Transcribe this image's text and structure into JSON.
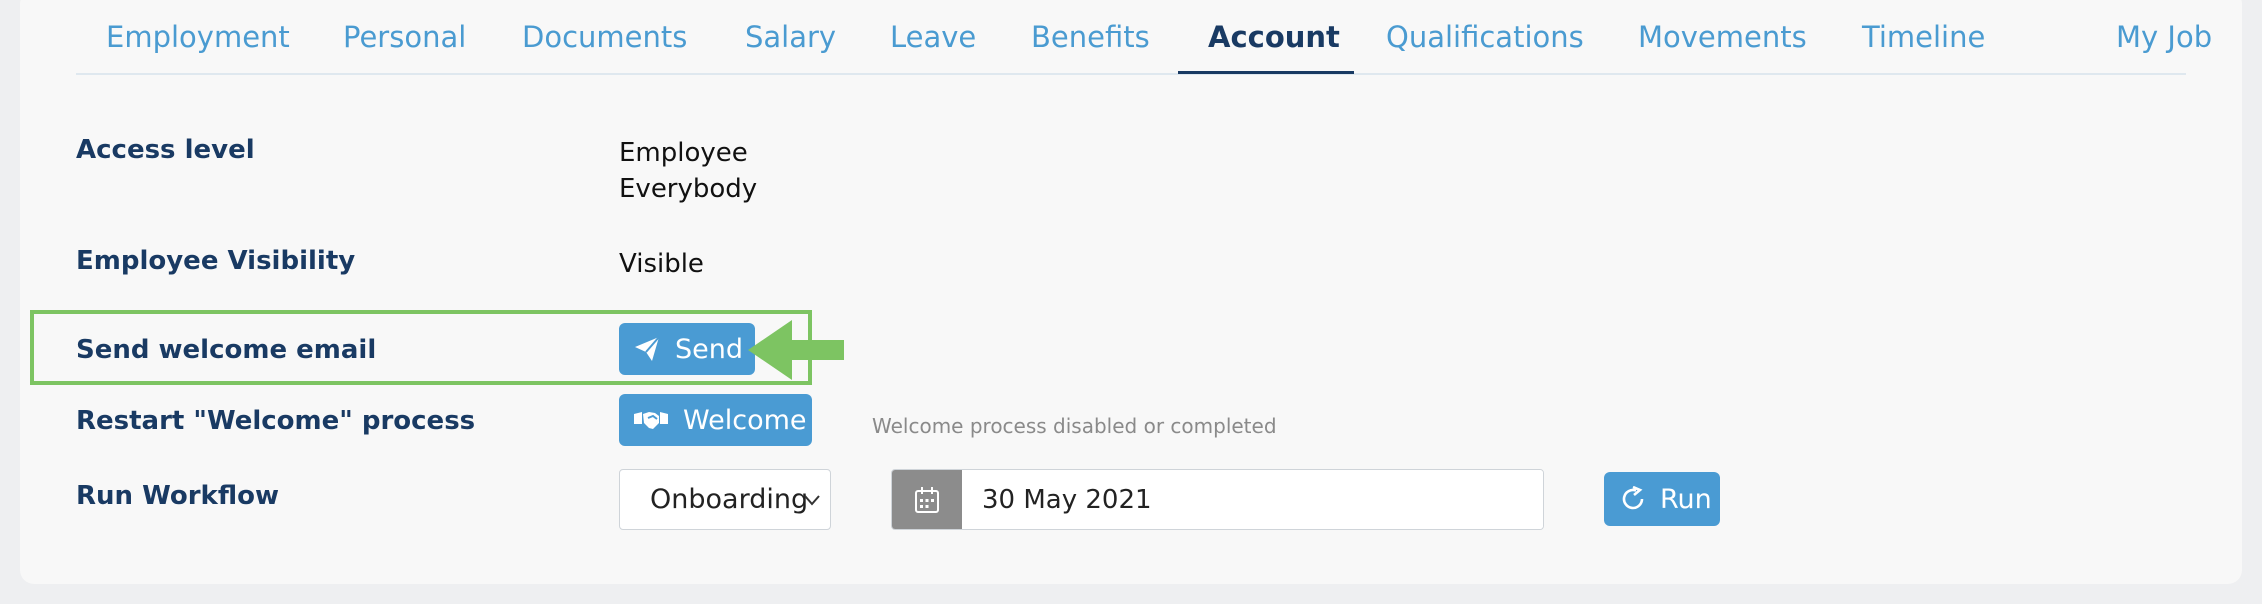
{
  "tabs": [
    {
      "label": "Employment"
    },
    {
      "label": "Personal"
    },
    {
      "label": "Documents"
    },
    {
      "label": "Salary"
    },
    {
      "label": "Leave"
    },
    {
      "label": "Benefits"
    },
    {
      "label": "Account",
      "active": true
    },
    {
      "label": "Qualifications"
    },
    {
      "label": "Movements"
    },
    {
      "label": "Timeline"
    },
    {
      "label": "My Job"
    }
  ],
  "access": {
    "label": "Access level",
    "value_line1": "Employee",
    "value_line2": "Everybody"
  },
  "visibility": {
    "label": "Employee Visibility",
    "value": "Visible"
  },
  "welcome_email": {
    "label": "Send welcome email",
    "button": "Send",
    "button_icon": "paper-plane-icon"
  },
  "restart": {
    "label": "Restart \"Welcome\" process",
    "button": "Welcome",
    "button_icon": "handshake-icon",
    "note": "Welcome process disabled or completed"
  },
  "workflow": {
    "label": "Run Workflow",
    "selected": "Onboarding",
    "date": "30 May 2021",
    "run_button": "Run",
    "run_icon": "refresh-icon"
  },
  "colors": {
    "accent": "#4a9bd3",
    "heading": "#193a63",
    "highlight": "#7dc462"
  }
}
